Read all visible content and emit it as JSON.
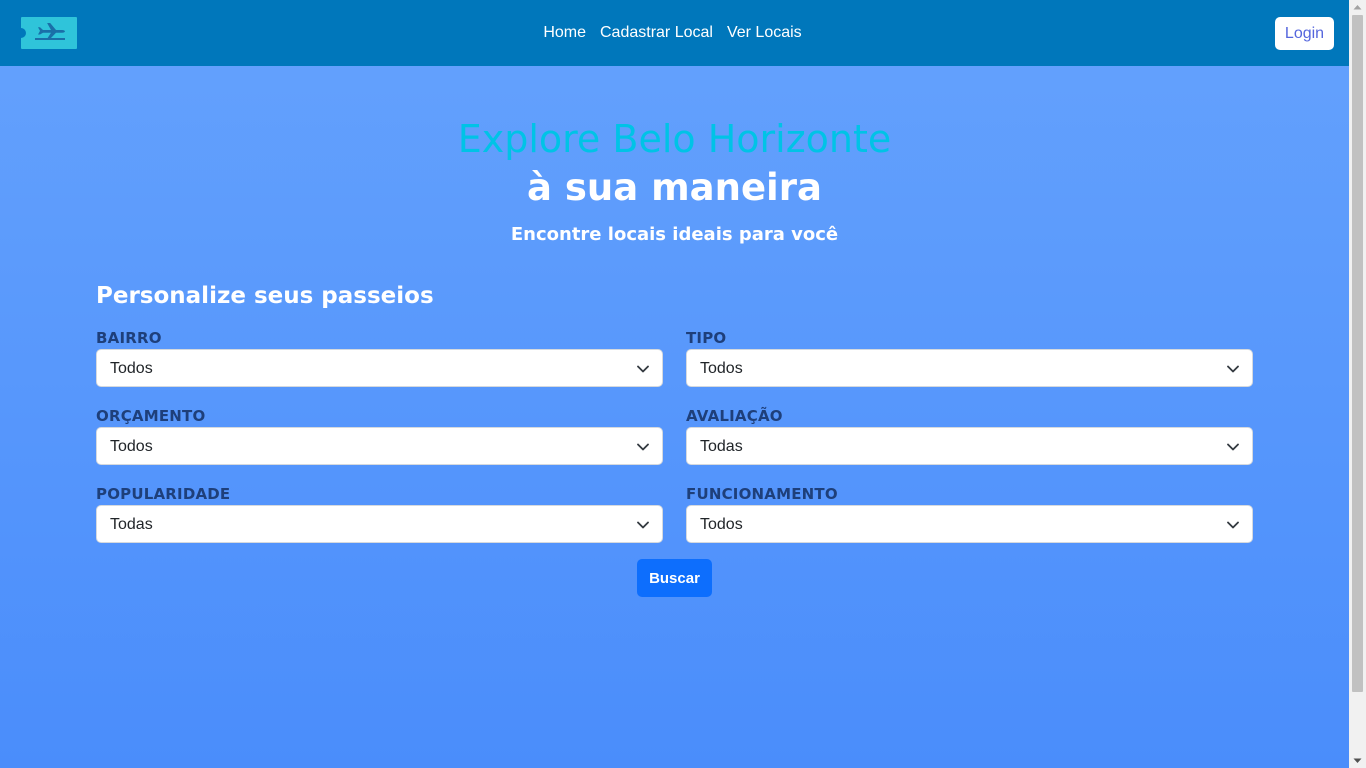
{
  "nav": {
    "logo_icon": "airplane-ticket-icon",
    "links": [
      {
        "label": "Home"
      },
      {
        "label": "Cadastrar Local"
      },
      {
        "label": "Ver Locais"
      }
    ],
    "login_label": "Login"
  },
  "hero": {
    "title_line1": "Explore Belo Horizonte",
    "title_line2": "à sua maneira",
    "subtitle": "Encontre locais ideais para você"
  },
  "filters": {
    "section_title": "Personalize seus passeios",
    "fields": [
      {
        "label": "BAIRRO",
        "value": "Todos"
      },
      {
        "label": "TIPO",
        "value": "Todos"
      },
      {
        "label": "ORÇAMENTO",
        "value": "Todos"
      },
      {
        "label": "AVALIAÇÃO",
        "value": "Todas"
      },
      {
        "label": "POPULARIDADE",
        "value": "Todas"
      },
      {
        "label": "FUNCIONAMENTO",
        "value": "Todos"
      }
    ],
    "search_label": "Buscar"
  },
  "colors": {
    "navbar": "#0077bb",
    "logo": "#2fc4da",
    "title_accent": "#00c3e6",
    "background_top": "#65a2fd",
    "background_bottom": "#4a8dfb",
    "button": "#0d6efd",
    "label": "#1e3f7a"
  }
}
